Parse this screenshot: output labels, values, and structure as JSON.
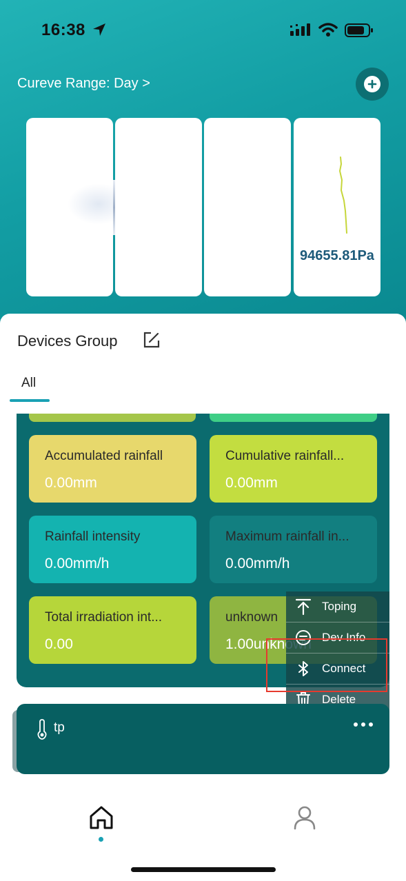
{
  "status_bar": {
    "time": "16:38"
  },
  "header": {
    "curve_range_label": "Cureve Range: Day >"
  },
  "chart_cards": {
    "pressure_value": "94655.81Pa"
  },
  "devices_group": {
    "title": "Devices Group",
    "tabs": [
      {
        "label": "All",
        "active": true
      }
    ]
  },
  "group_tiles": [
    {
      "label": "Accumulated rainfall",
      "value": "0.00mm",
      "color": "#e7d86c"
    },
    {
      "label": "Cumulative rainfall...",
      "value": "0.00mm",
      "color": "#c3dd40"
    },
    {
      "label": "Rainfall intensity",
      "value": "0.00mm/h",
      "color": "#14b3b0"
    },
    {
      "label": "Maximum rainfall in...",
      "value": "0.00mm/h",
      "color": "#127f80"
    },
    {
      "label": "Total irradiation int...",
      "value": "0.00",
      "color": "#b6d63a"
    },
    {
      "label": "unknown",
      "value": "1.00unknown",
      "color": "#8fb541"
    }
  ],
  "context_menu": {
    "items": [
      {
        "label": "Toping",
        "icon": "pin-top-icon"
      },
      {
        "label": "Dev Info",
        "icon": "info-icon"
      },
      {
        "label": "Connect",
        "icon": "bluetooth-icon"
      },
      {
        "label": "Delete",
        "icon": "trash-icon"
      }
    ]
  },
  "device_card": {
    "name": "tp",
    "icon": "thermometer-icon"
  },
  "bottom_nav": {
    "items": [
      {
        "icon": "home-icon",
        "active": true
      },
      {
        "icon": "user-icon",
        "active": false
      }
    ]
  },
  "colors": {
    "accent": "#1aa1b4",
    "header_teal": "#139ea4",
    "panel_teal": "#0b6b6e",
    "highlight": "#e63a2e"
  }
}
